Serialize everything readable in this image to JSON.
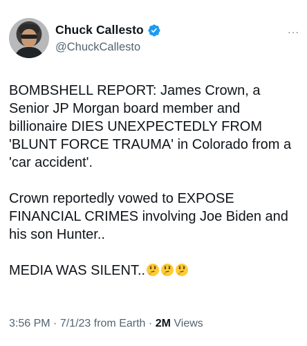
{
  "user": {
    "display_name": "Chuck Callesto",
    "handle": "@ChuckCallesto",
    "verified_color": "#1d9bf0"
  },
  "menu": {
    "more_icon": "ellipsis-icon",
    "more_glyph": "···"
  },
  "tweet": {
    "paragraphs": [
      "BOMBSHELL REPORT: James Crown, a Senior JP Morgan board member and billionaire DIES UNEXPECTEDLY FROM 'BLUNT FORCE TRAUMA' in Colorado from a 'car accident'.",
      "Crown reportedly vowed to EXPOSE FINANCIAL CRIMES involving Joe Biden and his son Hunter.."
    ],
    "final_text": "MEDIA WAS SILENT..",
    "emojis": [
      "thinking-face",
      "thinking-face",
      "thinking-face"
    ]
  },
  "meta": {
    "time": "3:56 PM",
    "dot1": "·",
    "date_source": "7/1/23 from Earth",
    "dot2": "·",
    "views_count": "2M",
    "views_label": "Views"
  }
}
